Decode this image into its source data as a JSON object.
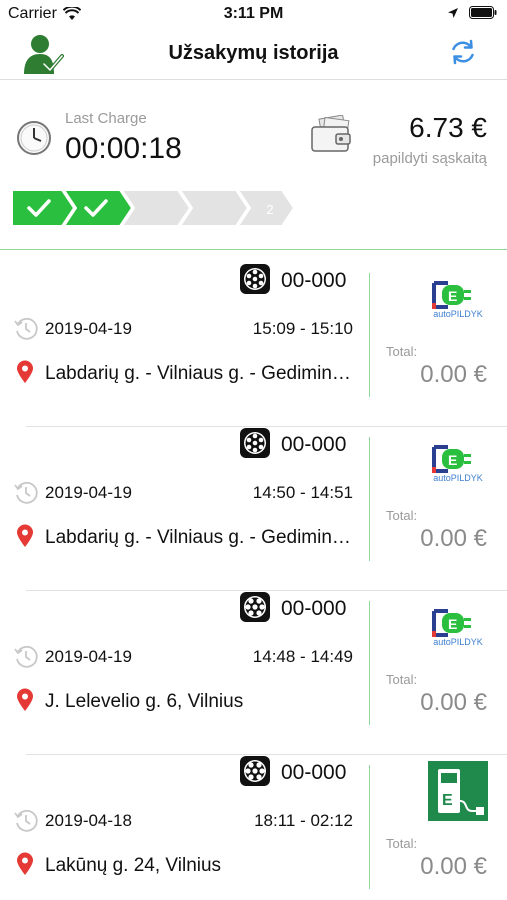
{
  "status_bar": {
    "carrier": "Carrier",
    "time": "3:11 PM"
  },
  "nav": {
    "title": "Užsakymų istorija"
  },
  "summary": {
    "last_charge_label": "Last Charge",
    "last_charge_value": "00:00:18",
    "balance": "6.73 €",
    "topup_label": "papildyti sąskaitą",
    "progress": {
      "completed_steps": 2,
      "total_steps": 5,
      "remaining_label": "2"
    }
  },
  "accent_colors": {
    "green": "#2bbf3f",
    "pin_red": "#e53935",
    "refresh_blue": "#3d8fe3"
  },
  "orders": [
    {
      "code": "00-000",
      "date": "2019-04-19",
      "time": "15:09 - 15:10",
      "address": "Labdarių g. - Vilniaus g. - Gedimino pr.",
      "total_label": "Total:",
      "total": "0.00 €",
      "logo": "autopildyk-logo",
      "logo_text": "autoPILDYK",
      "plug_icon": "type2-plug-icon"
    },
    {
      "code": "00-000",
      "date": "2019-04-19",
      "time": "14:50 - 14:51",
      "address": "Labdarių g. - Vilniaus g. - Gedimino pr.",
      "total_label": "Total:",
      "total": "0.00 €",
      "logo": "autopildyk-logo",
      "logo_text": "autoPILDYK",
      "plug_icon": "type2-plug-icon"
    },
    {
      "code": "00-000",
      "date": "2019-04-19",
      "time": "14:48 - 14:49",
      "address": "J. Lelevelio g. 6, Vilnius",
      "total_label": "Total:",
      "total": "0.00 €",
      "logo": "autopildyk-logo",
      "logo_text": "autoPILDYK",
      "plug_icon": "ccs-plug-icon"
    },
    {
      "code": "00-000",
      "date": "2019-04-18",
      "time": "18:11 - 02:12",
      "address": "Lakūnų g. 24, Vilnius",
      "total_label": "Total:",
      "total": "0.00 €",
      "logo": "e-charging-station-logo",
      "logo_text": "",
      "plug_icon": "ccs-plug-icon"
    }
  ]
}
